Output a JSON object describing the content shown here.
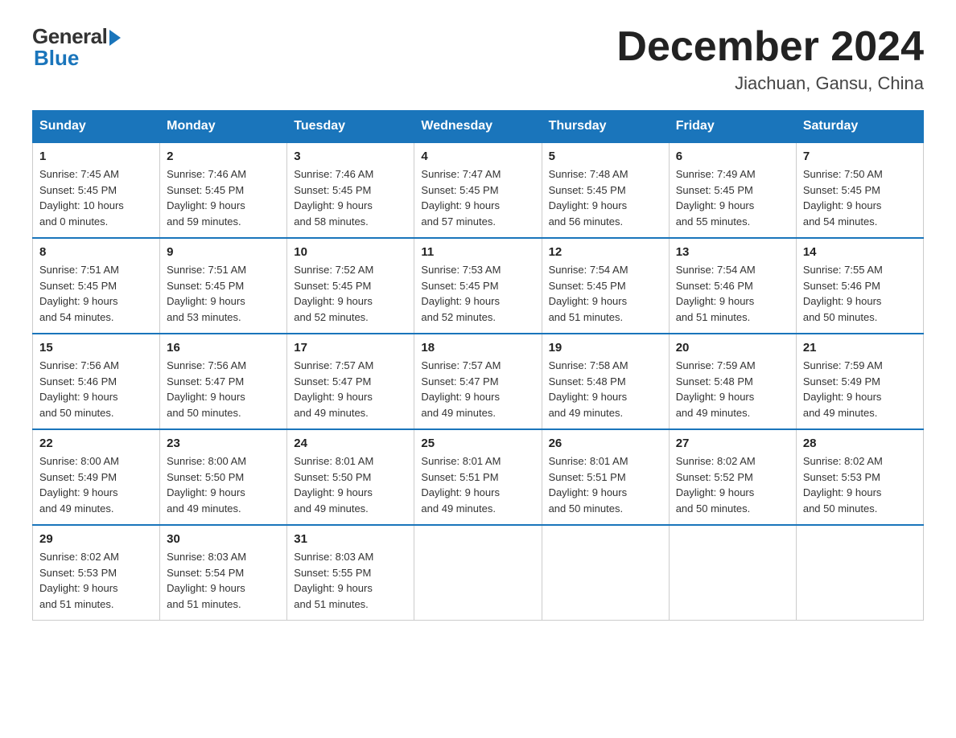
{
  "logo": {
    "general": "General",
    "blue": "Blue"
  },
  "title": {
    "month": "December 2024",
    "location": "Jiachuan, Gansu, China"
  },
  "weekdays": [
    "Sunday",
    "Monday",
    "Tuesday",
    "Wednesday",
    "Thursday",
    "Friday",
    "Saturday"
  ],
  "weeks": [
    [
      {
        "day": "1",
        "sunrise": "7:45 AM",
        "sunset": "5:45 PM",
        "daylight": "10 hours and 0 minutes."
      },
      {
        "day": "2",
        "sunrise": "7:46 AM",
        "sunset": "5:45 PM",
        "daylight": "9 hours and 59 minutes."
      },
      {
        "day": "3",
        "sunrise": "7:46 AM",
        "sunset": "5:45 PM",
        "daylight": "9 hours and 58 minutes."
      },
      {
        "day": "4",
        "sunrise": "7:47 AM",
        "sunset": "5:45 PM",
        "daylight": "9 hours and 57 minutes."
      },
      {
        "day": "5",
        "sunrise": "7:48 AM",
        "sunset": "5:45 PM",
        "daylight": "9 hours and 56 minutes."
      },
      {
        "day": "6",
        "sunrise": "7:49 AM",
        "sunset": "5:45 PM",
        "daylight": "9 hours and 55 minutes."
      },
      {
        "day": "7",
        "sunrise": "7:50 AM",
        "sunset": "5:45 PM",
        "daylight": "9 hours and 54 minutes."
      }
    ],
    [
      {
        "day": "8",
        "sunrise": "7:51 AM",
        "sunset": "5:45 PM",
        "daylight": "9 hours and 54 minutes."
      },
      {
        "day": "9",
        "sunrise": "7:51 AM",
        "sunset": "5:45 PM",
        "daylight": "9 hours and 53 minutes."
      },
      {
        "day": "10",
        "sunrise": "7:52 AM",
        "sunset": "5:45 PM",
        "daylight": "9 hours and 52 minutes."
      },
      {
        "day": "11",
        "sunrise": "7:53 AM",
        "sunset": "5:45 PM",
        "daylight": "9 hours and 52 minutes."
      },
      {
        "day": "12",
        "sunrise": "7:54 AM",
        "sunset": "5:45 PM",
        "daylight": "9 hours and 51 minutes."
      },
      {
        "day": "13",
        "sunrise": "7:54 AM",
        "sunset": "5:46 PM",
        "daylight": "9 hours and 51 minutes."
      },
      {
        "day": "14",
        "sunrise": "7:55 AM",
        "sunset": "5:46 PM",
        "daylight": "9 hours and 50 minutes."
      }
    ],
    [
      {
        "day": "15",
        "sunrise": "7:56 AM",
        "sunset": "5:46 PM",
        "daylight": "9 hours and 50 minutes."
      },
      {
        "day": "16",
        "sunrise": "7:56 AM",
        "sunset": "5:47 PM",
        "daylight": "9 hours and 50 minutes."
      },
      {
        "day": "17",
        "sunrise": "7:57 AM",
        "sunset": "5:47 PM",
        "daylight": "9 hours and 49 minutes."
      },
      {
        "day": "18",
        "sunrise": "7:57 AM",
        "sunset": "5:47 PM",
        "daylight": "9 hours and 49 minutes."
      },
      {
        "day": "19",
        "sunrise": "7:58 AM",
        "sunset": "5:48 PM",
        "daylight": "9 hours and 49 minutes."
      },
      {
        "day": "20",
        "sunrise": "7:59 AM",
        "sunset": "5:48 PM",
        "daylight": "9 hours and 49 minutes."
      },
      {
        "day": "21",
        "sunrise": "7:59 AM",
        "sunset": "5:49 PM",
        "daylight": "9 hours and 49 minutes."
      }
    ],
    [
      {
        "day": "22",
        "sunrise": "8:00 AM",
        "sunset": "5:49 PM",
        "daylight": "9 hours and 49 minutes."
      },
      {
        "day": "23",
        "sunrise": "8:00 AM",
        "sunset": "5:50 PM",
        "daylight": "9 hours and 49 minutes."
      },
      {
        "day": "24",
        "sunrise": "8:01 AM",
        "sunset": "5:50 PM",
        "daylight": "9 hours and 49 minutes."
      },
      {
        "day": "25",
        "sunrise": "8:01 AM",
        "sunset": "5:51 PM",
        "daylight": "9 hours and 49 minutes."
      },
      {
        "day": "26",
        "sunrise": "8:01 AM",
        "sunset": "5:51 PM",
        "daylight": "9 hours and 50 minutes."
      },
      {
        "day": "27",
        "sunrise": "8:02 AM",
        "sunset": "5:52 PM",
        "daylight": "9 hours and 50 minutes."
      },
      {
        "day": "28",
        "sunrise": "8:02 AM",
        "sunset": "5:53 PM",
        "daylight": "9 hours and 50 minutes."
      }
    ],
    [
      {
        "day": "29",
        "sunrise": "8:02 AM",
        "sunset": "5:53 PM",
        "daylight": "9 hours and 51 minutes."
      },
      {
        "day": "30",
        "sunrise": "8:03 AM",
        "sunset": "5:54 PM",
        "daylight": "9 hours and 51 minutes."
      },
      {
        "day": "31",
        "sunrise": "8:03 AM",
        "sunset": "5:55 PM",
        "daylight": "9 hours and 51 minutes."
      },
      null,
      null,
      null,
      null
    ]
  ],
  "labels": {
    "sunrise": "Sunrise:",
    "sunset": "Sunset:",
    "daylight": "Daylight:"
  }
}
